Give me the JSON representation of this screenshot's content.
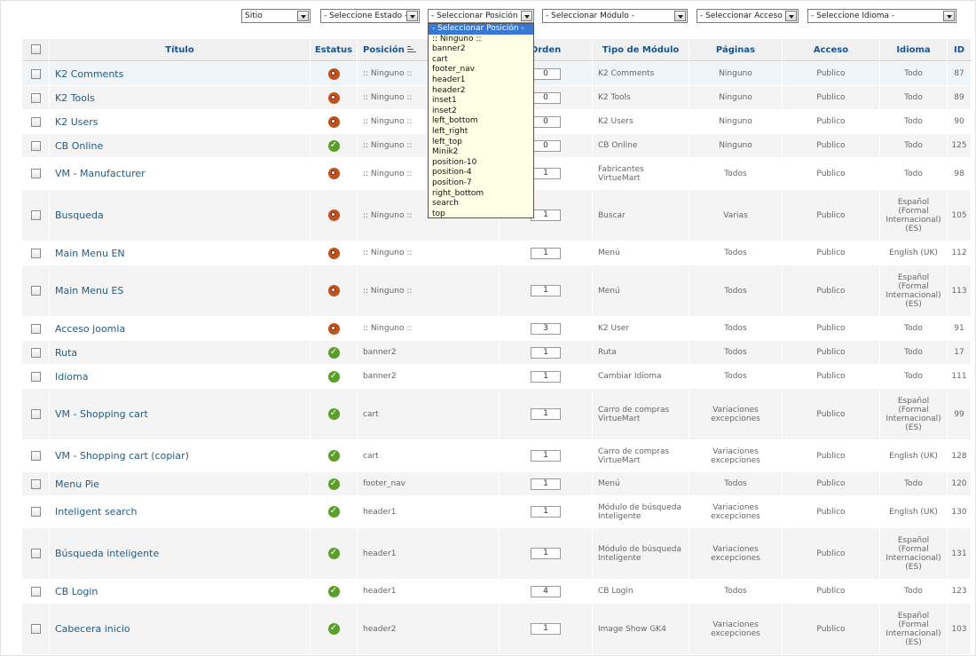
{
  "filters": {
    "client": "Sitio",
    "state": "- Seleccione Estado -",
    "position": "- Seleccionar Posición -",
    "module": "- Seleccionar Módulo -",
    "access": "- Seleccionar Acceso -",
    "language": "- Seleccione Idioma -"
  },
  "position_options": [
    "- Seleccionar Posición -",
    ":: Ninguno ::",
    "banner2",
    "cart",
    "footer_nav",
    "header1",
    "header2",
    "inset1",
    "inset2",
    "left_bottom",
    "left_right",
    "left_top",
    "Minik2",
    "position-10",
    "position-4",
    "position-7",
    "right_bottom",
    "search",
    "top"
  ],
  "columns": {
    "title": "Título",
    "status": "Estatus",
    "position": "Posición",
    "order": "Orden",
    "type": "Tipo de Módulo",
    "pages": "Páginas",
    "access": "Acceso",
    "language": "Idioma",
    "id": "ID"
  },
  "status_colors": {
    "published": "#5a9f2a",
    "unpublished": "#c0521f"
  },
  "rows": [
    {
      "title": "K2 Comments",
      "status": "unpublished",
      "position": ":: Ninguno ::",
      "order": "0",
      "type": "K2 Comments",
      "pages": "Ninguno",
      "access": "Publico",
      "language": "Todo",
      "id": "87"
    },
    {
      "title": "K2 Tools",
      "status": "unpublished",
      "position": ":: Ninguno ::",
      "order": "0",
      "type": "K2 Tools",
      "pages": "Ninguno",
      "access": "Publico",
      "language": "Todo",
      "id": "89"
    },
    {
      "title": "K2 Users",
      "status": "unpublished",
      "position": ":: Ninguno ::",
      "order": "0",
      "type": "K2 Users",
      "pages": "Ninguno",
      "access": "Publico",
      "language": "Todo",
      "id": "90"
    },
    {
      "title": "CB Online",
      "status": "published",
      "position": ":: Ninguno ::",
      "order": "0",
      "type": "CB Online",
      "pages": "Ninguno",
      "access": "Publico",
      "language": "Todo",
      "id": "125"
    },
    {
      "title": "VM - Manufacturer",
      "status": "unpublished",
      "position": ":: Ninguno ::",
      "order": "1",
      "type": "Fabricantes VirtueMart",
      "pages": "Todos",
      "access": "Publico",
      "language": "Todo",
      "id": "98"
    },
    {
      "title": "Busqueda",
      "status": "unpublished",
      "position": ":: Ninguno ::",
      "order": "1",
      "type": "Buscar",
      "pages": "Varias",
      "access": "Publico",
      "language": "Español (Formal Internacional) (ES)",
      "id": "105"
    },
    {
      "title": "Main Menu EN",
      "status": "unpublished",
      "position": ":: Ninguno ::",
      "order": "1",
      "type": "Menú",
      "pages": "Todos",
      "access": "Publico",
      "language": "English (UK)",
      "id": "112"
    },
    {
      "title": "Main Menu ES",
      "status": "unpublished",
      "position": ":: Ninguno ::",
      "order": "1",
      "type": "Menú",
      "pages": "Todos",
      "access": "Publico",
      "language": "Español (Formal Internacional) (ES)",
      "id": "113"
    },
    {
      "title": "Acceso joomla",
      "status": "unpublished",
      "position": ":: Ninguno ::",
      "order": "3",
      "type": "K2 User",
      "pages": "Todos",
      "access": "Publico",
      "language": "Todo",
      "id": "91"
    },
    {
      "title": "Ruta",
      "status": "published",
      "position": "banner2",
      "order": "1",
      "type": "Ruta",
      "pages": "Todos",
      "access": "Publico",
      "language": "Todo",
      "id": "17"
    },
    {
      "title": "Idioma",
      "status": "published",
      "position": "banner2",
      "order": "1",
      "type": "Cambiar Idioma",
      "pages": "Todos",
      "access": "Publico",
      "language": "Todo",
      "id": "111"
    },
    {
      "title": "VM - Shopping cart",
      "status": "published",
      "position": "cart",
      "order": "1",
      "type": "Carro de compras VirtueMart",
      "pages": "Variaciones excepciones",
      "access": "Publico",
      "language": "Español (Formal Internacional) (ES)",
      "id": "99"
    },
    {
      "title": "VM - Shopping cart (copiar)",
      "status": "published",
      "position": "cart",
      "order": "1",
      "type": "Carro de compras VirtueMart",
      "pages": "Variaciones excepciones",
      "access": "Publico",
      "language": "English (UK)",
      "id": "128"
    },
    {
      "title": "Menu Pie",
      "status": "published",
      "position": "footer_nav",
      "order": "1",
      "type": "Menú",
      "pages": "Todos",
      "access": "Publico",
      "language": "Todo",
      "id": "120"
    },
    {
      "title": "Inteligent search",
      "status": "published",
      "position": "header1",
      "order": "1",
      "type": "Módulo de búsqueda Inteligente",
      "pages": "Variaciones excepciones",
      "access": "Publico",
      "language": "English (UK)",
      "id": "130"
    },
    {
      "title": "Búsqueda inteligente",
      "status": "published",
      "position": "header1",
      "order": "1",
      "type": "Módulo de búsqueda Inteligente",
      "pages": "Variaciones excepciones",
      "access": "Publico",
      "language": "Español (Formal Internacional) (ES)",
      "id": "131"
    },
    {
      "title": "CB Login",
      "status": "published",
      "position": "header1",
      "order": "4",
      "type": "CB Login",
      "pages": "Todos",
      "access": "Publico",
      "language": "Todo",
      "id": "123"
    },
    {
      "title": "Cabecera inicio",
      "status": "published",
      "position": "header2",
      "order": "1",
      "type": "Image Show GK4",
      "pages": "Variaciones excepciones",
      "access": "Publico",
      "language": "Español (Formal Internacional) (ES)",
      "id": "103"
    }
  ]
}
